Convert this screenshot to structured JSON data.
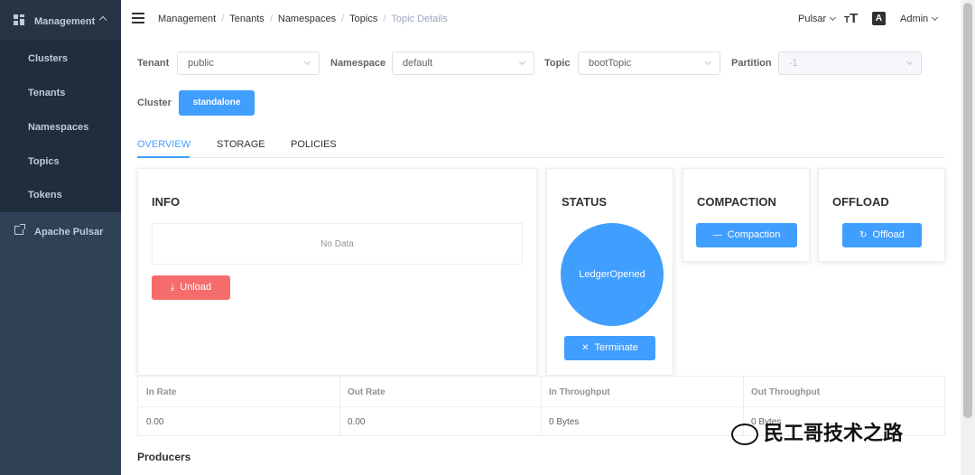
{
  "sidebar": {
    "group_label": "Management",
    "items": [
      {
        "label": "Clusters"
      },
      {
        "label": "Tenants"
      },
      {
        "label": "Namespaces"
      },
      {
        "label": "Topics"
      },
      {
        "label": "Tokens"
      }
    ],
    "external_link": "Apache Pulsar"
  },
  "header": {
    "breadcrumb": [
      "Management",
      "Tenants",
      "Namespaces",
      "Topics"
    ],
    "breadcrumb_current": "Topic Details",
    "environment": "Pulsar",
    "size_icon_glyph": "T",
    "language_icon_glyph": "A",
    "user": "Admin"
  },
  "filters": {
    "tenant": {
      "label": "Tenant",
      "value": "public"
    },
    "namespace": {
      "label": "Namespace",
      "value": "default"
    },
    "topic": {
      "label": "Topic",
      "value": "bootTopic"
    },
    "partition": {
      "label": "Partition",
      "value": "-1"
    },
    "cluster": {
      "label": "Cluster",
      "value": "standalone"
    }
  },
  "tabs": [
    {
      "label": "OVERVIEW",
      "active": true
    },
    {
      "label": "STORAGE",
      "active": false
    },
    {
      "label": "POLICIES",
      "active": false
    }
  ],
  "info": {
    "title": "INFO",
    "empty_text": "No Data",
    "unload_label": "Unload"
  },
  "status": {
    "title": "STATUS",
    "state": "LedgerOpened",
    "terminate_label": "Terminate"
  },
  "compaction": {
    "title": "COMPACTION",
    "button_label": "Compaction"
  },
  "offload": {
    "title": "OFFLOAD",
    "button_label": "Offload"
  },
  "rates": {
    "headers": [
      "In Rate",
      "Out Rate",
      "In Throughput",
      "Out Throughput"
    ],
    "values": [
      "0.00",
      "0.00",
      "0 Bytes",
      "0 Bytes"
    ]
  },
  "producers_title": "Producers",
  "watermark": "民工哥技术之路",
  "colors": {
    "primary": "#409eff",
    "danger": "#f56c6c",
    "sidebar": "#304156",
    "submenu": "#1f2d3d"
  }
}
